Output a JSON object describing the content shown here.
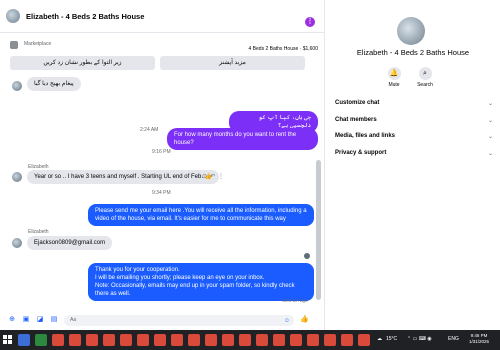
{
  "chat_header": {
    "title": "Elizabeth - 4 Beds 2 Baths House",
    "more_icon": "more-icon"
  },
  "marketplace": {
    "label": "Marketplace",
    "listing": "4 Beds 2 Baths House · $1,600",
    "btn_mark": "زیر التوا کے بطور نشان زد کریں",
    "btn_more": "مزید آپشنز"
  },
  "messages": {
    "m1_in": "پیغام بھیج دیا گیا",
    "t1": "2:24 AM",
    "m2_out": "جی ہاں، کیا آپ کو دلچسپی ہے؟",
    "m3_out": "For how many months do you want to rent the house?",
    "t2": "9:16 PM",
    "sender1": "Elizabeth",
    "m4_in": "Year or so .. I have 3 teens and myself . Starting UL end of Feb. 👍",
    "t3": "9:34 PM",
    "m5_out": "Please send me your email here .You will receive all the information, including a video of the house, via email. It's easier for me to communicate this way",
    "sender2": "Elizabeth",
    "m6_in": "Ejackson0809@gmail.com",
    "m7_out_1": "Thank you for your cooperation.",
    "m7_out_2": "I will be emailing you shortly; please keep an eye on your inbox.",
    "m7_out_3": "Note: Occasionally, emails may end up in your spam folder, so kindly check there as well.",
    "sent_label": "Sent 1m ago"
  },
  "composer": {
    "placeholder": "Aa",
    "icons": [
      "plus-icon",
      "image-icon",
      "sticker-icon",
      "gif-icon",
      "emoji-icon",
      "like-icon"
    ]
  },
  "side": {
    "name": "Elizabeth - 4 Beds 2 Baths House",
    "mute": "Mute",
    "search": "Search",
    "rows": [
      "Customize chat",
      "Chat members",
      "Media, files and links",
      "Privacy & support"
    ]
  },
  "taskbar": {
    "weather": "15°C",
    "lang": "ENG",
    "time": "9:46 PM",
    "date": "1/31/2025"
  },
  "colors": {
    "accent_blue": "#1a5cff",
    "accent_purple": "#7b2ff7",
    "taskbar": "#1f2124"
  }
}
